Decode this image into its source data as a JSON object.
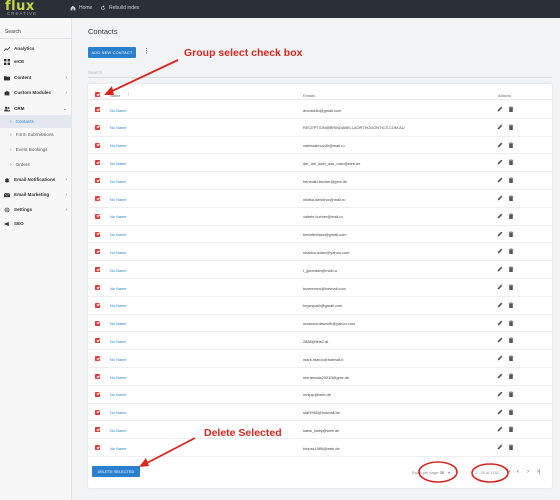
{
  "brand": {
    "name": "flux",
    "tagline": "CREATIVE"
  },
  "topnav": {
    "home": "Home",
    "rebuild": "Rebuild index"
  },
  "sidebar": {
    "search": "Search",
    "items": [
      {
        "label": "Analytics",
        "icon": "trending-icon",
        "chevron": ""
      },
      {
        "label": "eICE",
        "icon": "grid-icon",
        "chevron": ""
      },
      {
        "label": "Content",
        "icon": "folder-icon",
        "chevron": "›"
      },
      {
        "label": "Custom Modules",
        "icon": "puzzle-icon",
        "chevron": "›"
      },
      {
        "label": "CRM",
        "icon": "people-icon",
        "chevron": "⌄"
      },
      {
        "label": "Contacts",
        "icon": "",
        "chevron": "",
        "sub": true,
        "active": true
      },
      {
        "label": "Form Submissions",
        "icon": "",
        "chevron": "",
        "sub": true
      },
      {
        "label": "Event Bookings",
        "icon": "",
        "chevron": "",
        "sub": true
      },
      {
        "label": "Orders",
        "icon": "",
        "chevron": "",
        "sub": true
      },
      {
        "label": "Email Notifications",
        "icon": "bell-icon",
        "chevron": "›"
      },
      {
        "label": "Email Marketing",
        "icon": "mail-icon",
        "chevron": "›"
      },
      {
        "label": "Settings",
        "icon": "gear-icon",
        "chevron": "›"
      },
      {
        "label": "SEO",
        "icon": "megaphone-icon",
        "chevron": ""
      }
    ]
  },
  "page": {
    "title": "Contacts",
    "add_button": "ADD NEW CONTACT",
    "search_placeholder": "Search",
    "delete_button": "DELETE SELECTED"
  },
  "table": {
    "columns": {
      "name": "Name",
      "emails": "Emails",
      "actions": "Actions"
    },
    "rows": [
      {
        "name": "No Name",
        "email": "drcostello@gmail.com"
      },
      {
        "name": "No Name",
        "email": "RECEPTION@BRINDABELLAORTHODONTICS.COM.AU"
      },
      {
        "name": "No Name",
        "email": "valenasimov40@mail.ru"
      },
      {
        "name": "No Name",
        "email": "der_die_oder_das_max@web.de"
      },
      {
        "name": "No Name",
        "email": "benedikt.becker@gmx.de"
      },
      {
        "name": "No Name",
        "email": "nikitka.dimidrov@mail.ru"
      },
      {
        "name": "No Name",
        "email": "valerie.kucher@mail.ru"
      },
      {
        "name": "No Name",
        "email": "kevintheface@gmail.com"
      },
      {
        "name": "No Name",
        "email": "stratton.isidor@yahoo.com"
      },
      {
        "name": "No Name",
        "email": "t_garmash@mail.ru"
      },
      {
        "name": "No Name",
        "email": "tszeremcn@hotmail.com"
      },
      {
        "name": "No Name",
        "email": "keyespath@gmail.com"
      },
      {
        "name": "No Name",
        "email": "mosswordsworth@yahoo.com"
      },
      {
        "name": "No Name",
        "email": "2888@tele2.at"
      },
      {
        "name": "No Name",
        "email": "mark.ritardo@hotmail.it"
      },
      {
        "name": "No Name",
        "email": "meramoda20010@gmx.de"
      },
      {
        "name": "No Name",
        "email": "mnijop@web.de"
      },
      {
        "name": "No Name",
        "email": "staf1965@hotmail.be"
      },
      {
        "name": "No Name",
        "email": "sabsi_baby@web.de"
      },
      {
        "name": "No Name",
        "email": "tobpss1986@web.de"
      }
    ]
  },
  "pagination": {
    "rows_per_page_label": "Rows per page:",
    "rows_per_page": "20",
    "range": "1 - 20 of 1131"
  },
  "annotations": {
    "group_select": "Group select check box",
    "delete_selected": "Delete Selected"
  },
  "colors": {
    "accent": "#2a7fcf",
    "checkbox": "#e03a3a",
    "annotation": "#d8261f",
    "brand": "#c8d645"
  }
}
